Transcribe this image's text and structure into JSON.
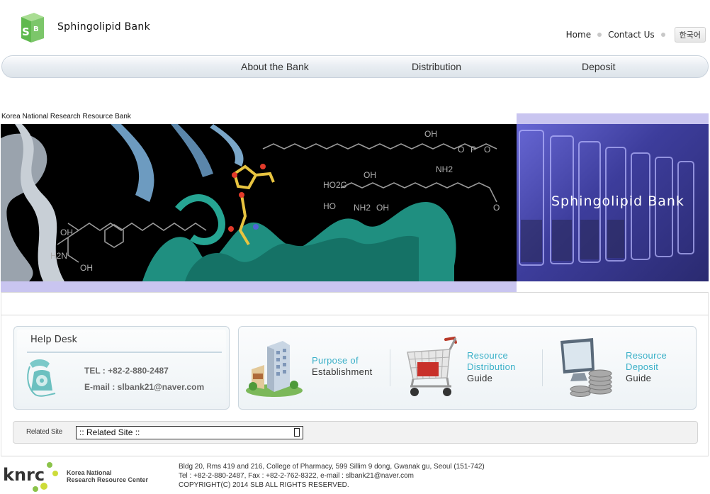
{
  "header": {
    "site_title": "Sphingolipid Bank",
    "logo_letters": "SB",
    "top_links": [
      "Home",
      "Contact Us"
    ],
    "lang_button": "한국어"
  },
  "main_nav": [
    "About the Bank",
    "Distribution",
    "Deposit"
  ],
  "banner": {
    "tagline": "Korea National Research Resource Bank",
    "title": "Sphingolipid Bank",
    "molecule_labels": [
      "OH",
      "OH",
      "NH2",
      "HO2C",
      "HO",
      "NH2",
      "OH",
      "O",
      "OH",
      "H2N",
      "OH",
      "O",
      "P",
      "O"
    ]
  },
  "help_desk": {
    "title": "Help Desk",
    "tel": "TEL : +82-2-880-2487",
    "email": "E-mail : slbank21@naver.com"
  },
  "guides": [
    {
      "line1": "Purpose of",
      "line2": "Establishment",
      "icon": "building-icon"
    },
    {
      "line1": "Resource",
      "line1b": "Distribution",
      "line2": "Guide",
      "icon": "shopping-cart-icon"
    },
    {
      "line1": "Resource",
      "line1b": "Deposit",
      "line2": "Guide",
      "icon": "computer-coins-icon"
    }
  ],
  "related_site": {
    "label": "Related Site",
    "selected": ":: Related Site ::"
  },
  "footer": {
    "logo_text": "knrc",
    "org_line1": "Korea National",
    "org_line2": "Research Resource Center",
    "address": "Bldg 20, Rms 419 and 216, College of Pharmacy, 599 Sillim 9 dong, Gwanak gu, Seoul (151-742)",
    "contact": "Tel : +82-2-880-2487, Fax : +82-2-762-8322, e-mail : slbank21@naver.com",
    "copyright": "COPYRIGHT(C) 2014 SLB ALL RIGHTS RESERVED."
  },
  "colors": {
    "accent_teal": "#3ab0c8",
    "banner_lavender": "#c9c5f0",
    "logo_green": "#7cc66a"
  }
}
